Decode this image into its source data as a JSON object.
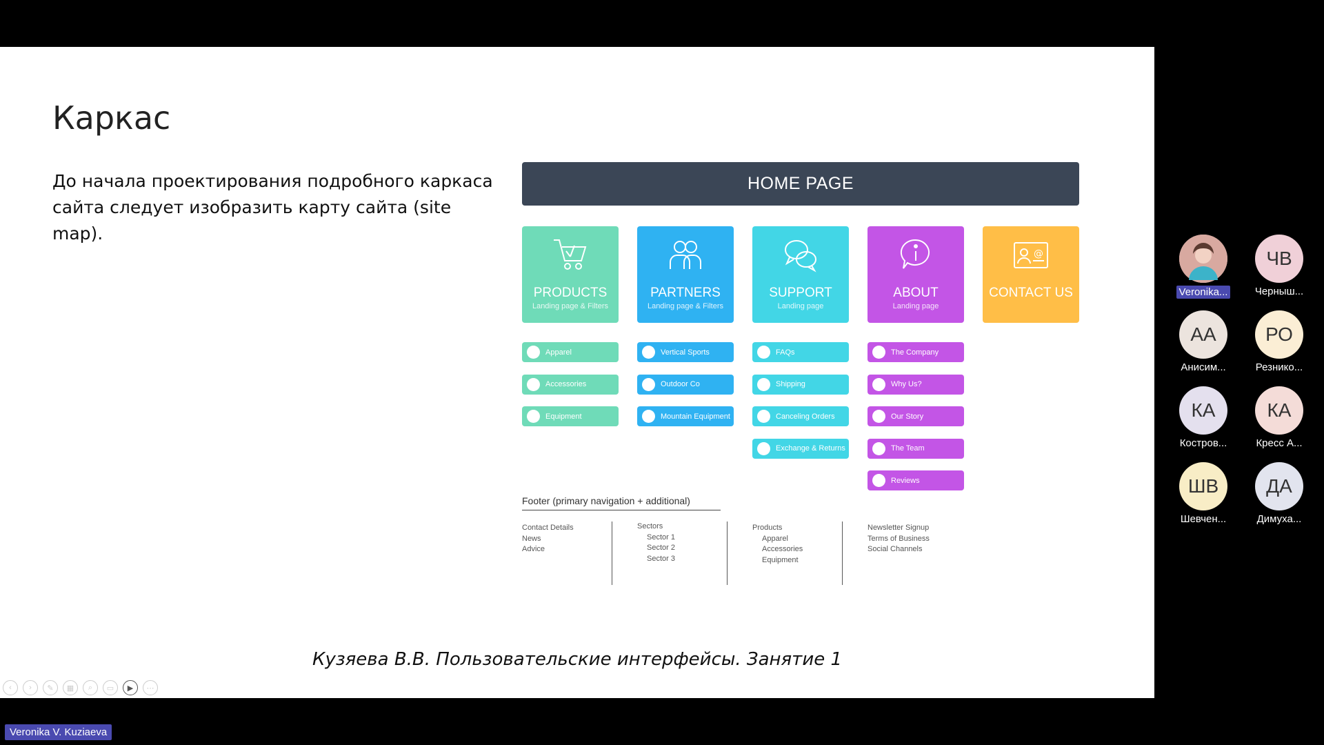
{
  "slide": {
    "title": "Каркас",
    "text": "До начала проектирования подробного каркаса сайта следует изобразить карту сайта (site map).",
    "footer": "Кузяева В.В. Пользовательские интерфейсы. Занятие 1"
  },
  "sitemap": {
    "home": "HOME PAGE",
    "sections": [
      {
        "title": "PRODUCTS",
        "subtitle": "Landing page & Filters",
        "color": "#6fdbb8",
        "icon": "cart-icon",
        "items": [
          "Apparel",
          "Accessories",
          "Equipment"
        ]
      },
      {
        "title": "PARTNERS",
        "subtitle": "Landing page & Filters",
        "color": "#2fb2f2",
        "icon": "people-icon",
        "items": [
          "Vertical Sports",
          "Outdoor Co",
          "Mountain Equipment"
        ]
      },
      {
        "title": "SUPPORT",
        "subtitle": "Landing page",
        "color": "#42d6e6",
        "icon": "chat-icon",
        "items": [
          "FAQs",
          "Shipping",
          "Canceling Orders",
          "Exchange & Returns"
        ]
      },
      {
        "title": "ABOUT",
        "subtitle": "Landing page",
        "color": "#c355e6",
        "icon": "info-icon",
        "items": [
          "The Company",
          "Why Us?",
          "Our Story",
          "The Team",
          "Reviews"
        ]
      },
      {
        "title": "CONTACT US",
        "subtitle": "",
        "color": "#ffbe47",
        "icon": "contact-card-icon",
        "items": []
      }
    ],
    "footer": {
      "title": "Footer (primary navigation + additional)",
      "col1": [
        "Contact Details",
        "News",
        "Advice"
      ],
      "col2_head": "Sectors",
      "col2": [
        "Sector 1",
        "Sector 2",
        "Sector 3"
      ],
      "col3_head": "Products",
      "col3": [
        "Apparel",
        "Accessories",
        "Equipment"
      ],
      "col4": [
        "Newsletter Signup",
        "Terms of Business",
        "Social Channels"
      ]
    }
  },
  "participants": [
    {
      "initials": "",
      "name": "Veronika...",
      "color": "#e9c9c9",
      "active": true
    },
    {
      "initials": "ЧВ",
      "name": "Черныш...",
      "color": "#f0d0d8"
    },
    {
      "initials": "АА",
      "name": "Анисим...",
      "color": "#ece4de"
    },
    {
      "initials": "РО",
      "name": "Резнико...",
      "color": "#fbeed5"
    },
    {
      "initials": "КА",
      "name": "Костров...",
      "color": "#e4e0ee"
    },
    {
      "initials": "КА",
      "name": "Кресс А...",
      "color": "#f4dcd8"
    },
    {
      "initials": "ШВ",
      "name": "Шевчен...",
      "color": "#f8edc6"
    },
    {
      "initials": "ДА",
      "name": "Димуха...",
      "color": "#e2e4ee"
    }
  ],
  "presenter_name": "Veronika V. Kuziaeva"
}
